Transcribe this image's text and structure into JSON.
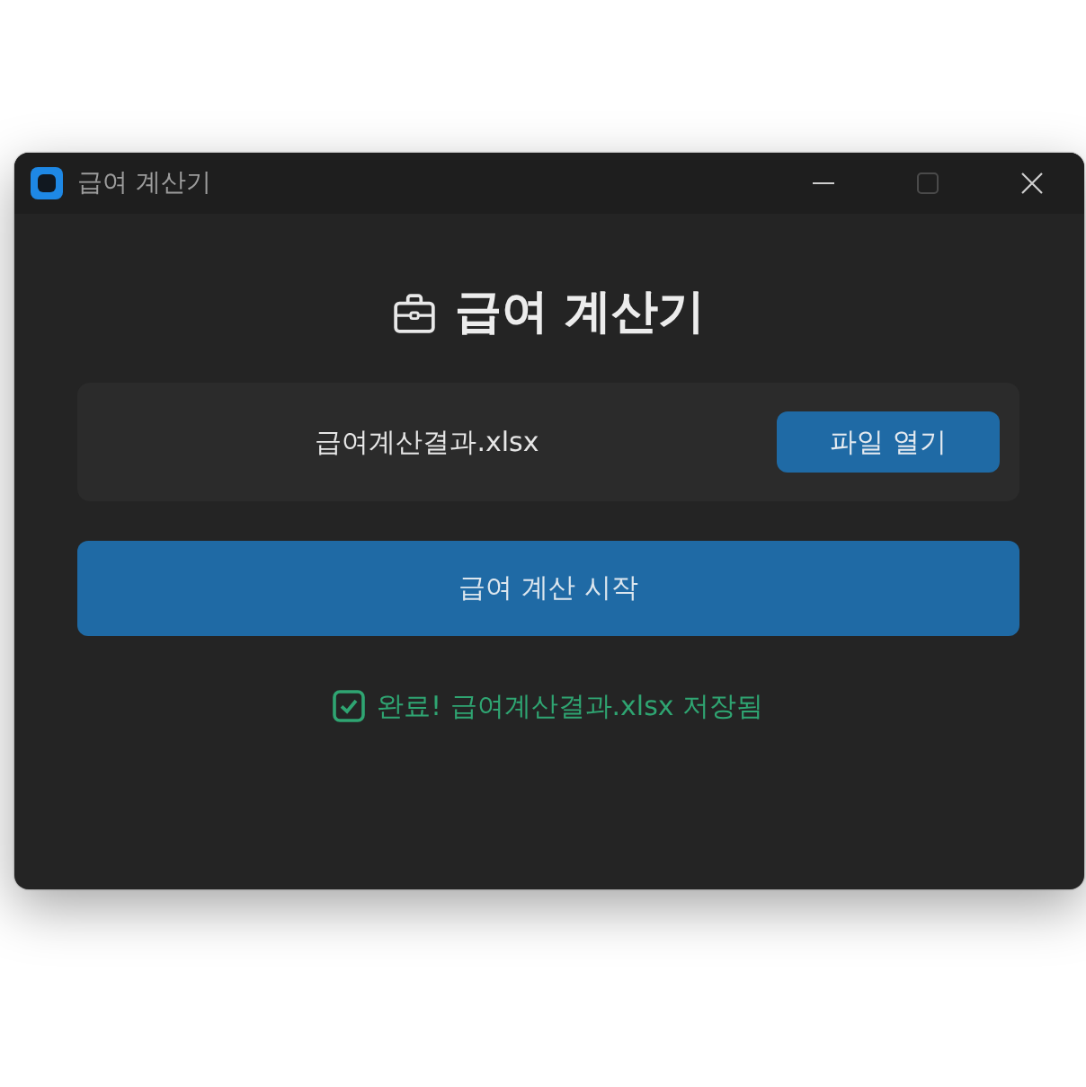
{
  "window": {
    "title": "급여 계산기",
    "maximize_disabled": true
  },
  "header": {
    "title": "급여 계산기"
  },
  "file": {
    "name": "급여계산결과.xlsx",
    "button": "파일 열기"
  },
  "start_button": "급여 계산 시작",
  "status": {
    "kind": "success",
    "text": "완료! 급여계산결과.xlsx 저장됨"
  }
}
